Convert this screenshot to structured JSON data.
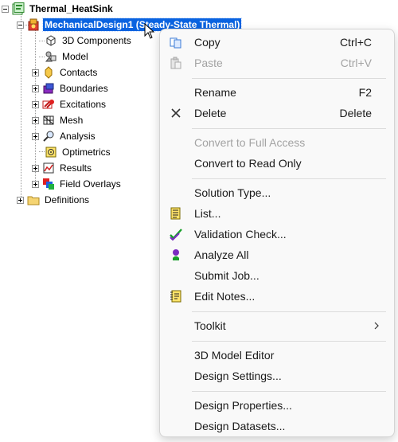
{
  "tree": {
    "root": {
      "label": "Thermal_HeatSink"
    },
    "design": {
      "label": "MechanicalDesign1 (Steady-State Thermal)"
    },
    "children": [
      {
        "label": "3D Components"
      },
      {
        "label": "Model"
      },
      {
        "label": "Contacts"
      },
      {
        "label": "Boundaries"
      },
      {
        "label": "Excitations"
      },
      {
        "label": "Mesh"
      },
      {
        "label": "Analysis"
      },
      {
        "label": "Optimetrics"
      },
      {
        "label": "Results"
      },
      {
        "label": "Field Overlays"
      }
    ],
    "definitions": {
      "label": "Definitions"
    }
  },
  "menu": {
    "copy": {
      "label": "Copy",
      "shortcut": "Ctrl+C"
    },
    "paste": {
      "label": "Paste",
      "shortcut": "Ctrl+V"
    },
    "rename": {
      "label": "Rename",
      "shortcut": "F2"
    },
    "delete": {
      "label": "Delete",
      "shortcut": "Delete"
    },
    "convert_full": {
      "label": "Convert to Full Access"
    },
    "convert_readonly": {
      "label": "Convert to Read Only"
    },
    "solution_type": {
      "label": "Solution Type..."
    },
    "list": {
      "label": "List..."
    },
    "validation_check": {
      "label": "Validation Check..."
    },
    "analyze_all": {
      "label": "Analyze All"
    },
    "submit_job": {
      "label": "Submit Job..."
    },
    "edit_notes": {
      "label": "Edit Notes..."
    },
    "toolkit": {
      "label": "Toolkit"
    },
    "model_editor": {
      "label": "3D Model Editor"
    },
    "design_settings": {
      "label": "Design Settings..."
    },
    "design_properties": {
      "label": "Design Properties..."
    },
    "design_datasets": {
      "label": "Design Datasets..."
    }
  }
}
